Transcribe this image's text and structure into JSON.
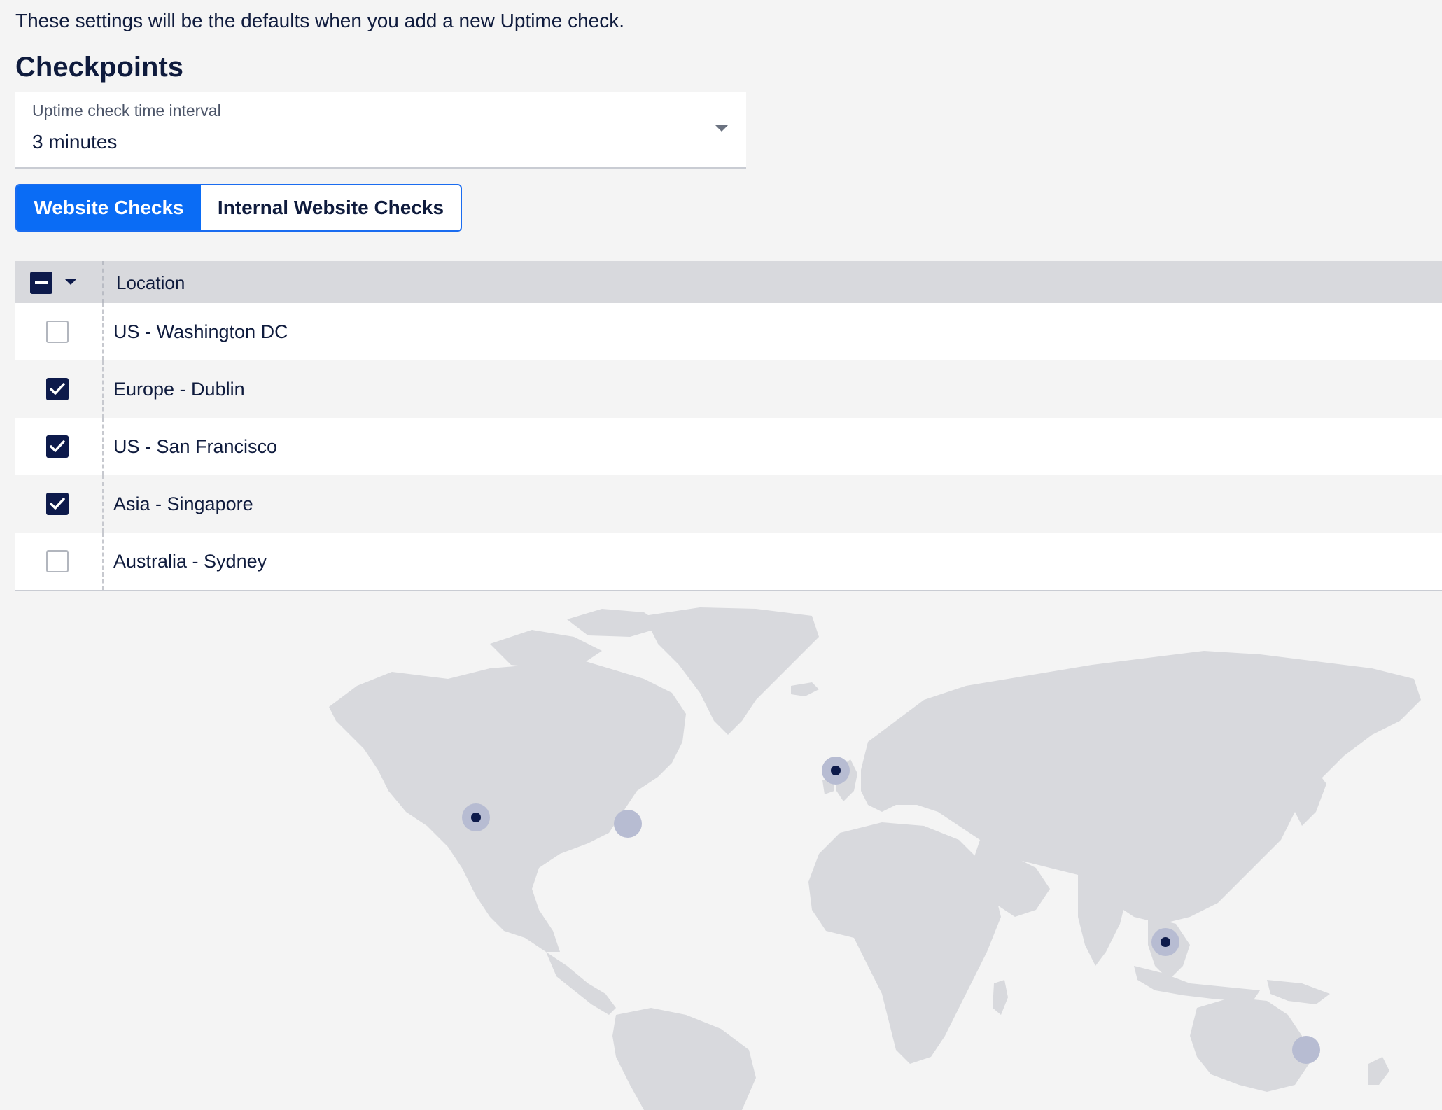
{
  "intro": "These settings will be the defaults when you add a new Uptime check.",
  "section_title": "Checkpoints",
  "interval_select": {
    "label": "Uptime check time interval",
    "value": "3 minutes"
  },
  "tabs": [
    {
      "label": "Website Checks",
      "active": true
    },
    {
      "label": "Internal Website Checks",
      "active": false
    }
  ],
  "table": {
    "header_select_state": "indeterminate",
    "column_header": "Location",
    "rows": [
      {
        "location": "US - Washington DC",
        "checked": false
      },
      {
        "location": "Europe - Dublin",
        "checked": true
      },
      {
        "location": "US - San Francisco",
        "checked": true
      },
      {
        "location": "Asia - Singapore",
        "checked": true
      },
      {
        "location": "Australia - Sydney",
        "checked": false
      }
    ]
  },
  "map": {
    "markers": [
      {
        "location": "US - Washington DC",
        "selected": false
      },
      {
        "location": "Europe - Dublin",
        "selected": true
      },
      {
        "location": "US - San Francisco",
        "selected": true
      },
      {
        "location": "Asia - Singapore",
        "selected": true
      },
      {
        "location": "Australia - Sydney",
        "selected": false
      }
    ]
  },
  "colors": {
    "primary": "#0a6cf5",
    "navy": "#0d1a4b",
    "land": "#d8d9dd",
    "marker_halo": "#b7bcd2"
  },
  "icons": {
    "header_checkbox": "indeterminate-checkbox-icon",
    "header_menu": "caret-down-icon",
    "select_caret": "caret-down-icon",
    "row_checked": "check-icon"
  }
}
